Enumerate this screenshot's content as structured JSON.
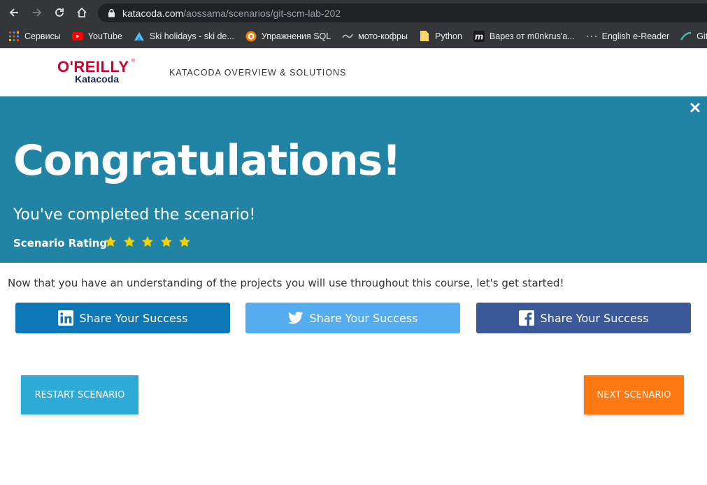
{
  "browser": {
    "url_host": "katacoda.com",
    "url_path": "/aossama/scenarios/git-scm-lab-202",
    "bookmarks": [
      {
        "label": "Сервисы",
        "icon": "apps-grid-icon"
      },
      {
        "label": "YouTube",
        "icon": "youtube-icon"
      },
      {
        "label": "Ski holidays - ski de...",
        "icon": "ski-icon"
      },
      {
        "label": "Упражнения SQL",
        "icon": "sql-icon"
      },
      {
        "label": "мото-кофры",
        "icon": "moto-icon"
      },
      {
        "label": "Python",
        "icon": "folder-icon"
      },
      {
        "label": "Варез от m0nkrus'a...",
        "icon": "m-icon"
      },
      {
        "label": "English e-Reader",
        "icon": "ereader-icon"
      },
      {
        "label": "Gitlab In",
        "icon": "gitlab-icon"
      }
    ]
  },
  "header": {
    "logo_brand": "O'REILLY",
    "logo_sub": "Katacoda",
    "nav_link": "KATACODA OVERVIEW & SOLUTIONS"
  },
  "banner": {
    "title": "Congratulations!",
    "subtitle": "You've completed the scenario!",
    "rating_label": "Scenario Rating",
    "rating": 5,
    "rating_max": 5
  },
  "main": {
    "intro": "Now that you have an understanding of the projects you will use throughout this course, let's get started!",
    "share": {
      "linkedin_label": "Share Your Success",
      "twitter_label": "Share Your Success",
      "facebook_label": "Share Your Success"
    },
    "restart_label": "RESTART SCENARIO",
    "next_label": "NEXT SCENARIO"
  },
  "colors": {
    "banner": "#2184a5",
    "linkedin": "#0e77b5",
    "twitter": "#55acee",
    "facebook": "#3b5998",
    "restart": "#2eaad7",
    "next": "#fe7812",
    "star": "#f5d300"
  }
}
